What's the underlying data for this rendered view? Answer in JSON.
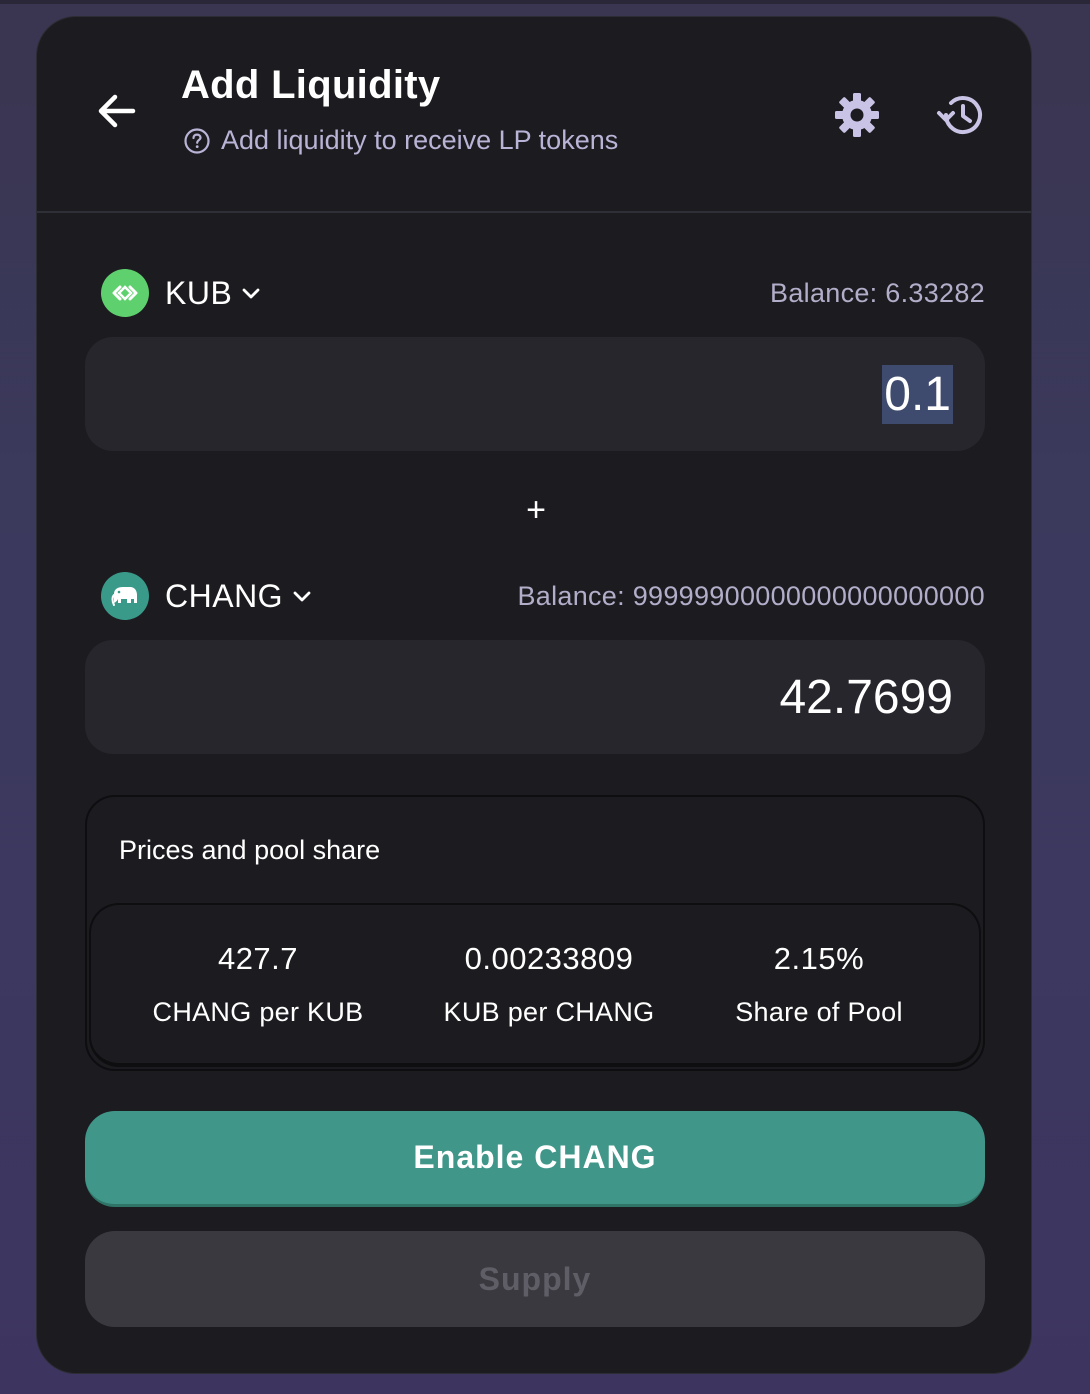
{
  "header": {
    "title": "Add Liquidity",
    "subtitle": "Add liquidity to receive LP tokens"
  },
  "token_a": {
    "symbol": "KUB",
    "balance": "Balance: 6.33282",
    "amount": "0.1",
    "logo_color": "#5fd06e"
  },
  "separator": "+",
  "token_b": {
    "symbol": "CHANG",
    "balance": "Balance: 99999900000000000000000",
    "amount": "42.7699",
    "logo_color": "#3a9a8a"
  },
  "pool": {
    "title": "Prices and pool share",
    "stats": [
      {
        "value": "427.7",
        "label": "CHANG per KUB"
      },
      {
        "value": "0.00233809",
        "label": "KUB per CHANG"
      },
      {
        "value": "2.15%",
        "label": "Share of Pool"
      }
    ]
  },
  "buttons": {
    "enable": "Enable CHANG",
    "supply": "Supply"
  },
  "colors": {
    "accent": "#41968a",
    "card_bg": "#1c1c20",
    "input_bg": "#26262c"
  }
}
